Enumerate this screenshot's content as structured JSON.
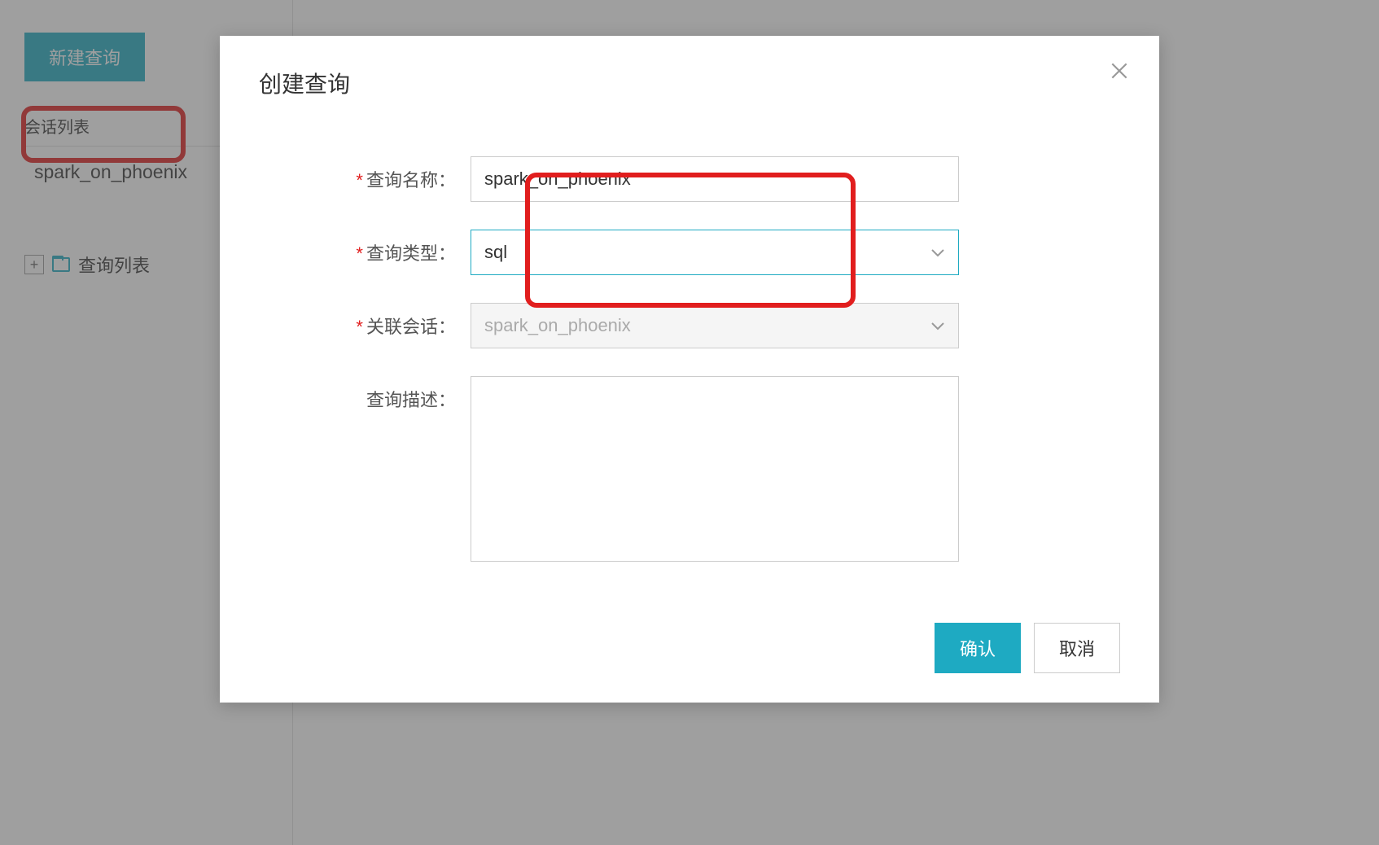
{
  "sidebar": {
    "new_query_button": "新建查询",
    "session_list_label": "会话列表",
    "session_item": "spark_on_phoenix",
    "query_list_label": "查询列表"
  },
  "modal": {
    "title": "创建查询",
    "fields": {
      "name_label": "查询名称：",
      "name_value": "spark_on_phoenix",
      "type_label": "查询类型：",
      "type_value": "sql",
      "session_label": "关联会话：",
      "session_value": "spark_on_phoenix",
      "desc_label": "查询描述：",
      "desc_value": ""
    },
    "confirm_button": "确认",
    "cancel_button": "取消"
  }
}
